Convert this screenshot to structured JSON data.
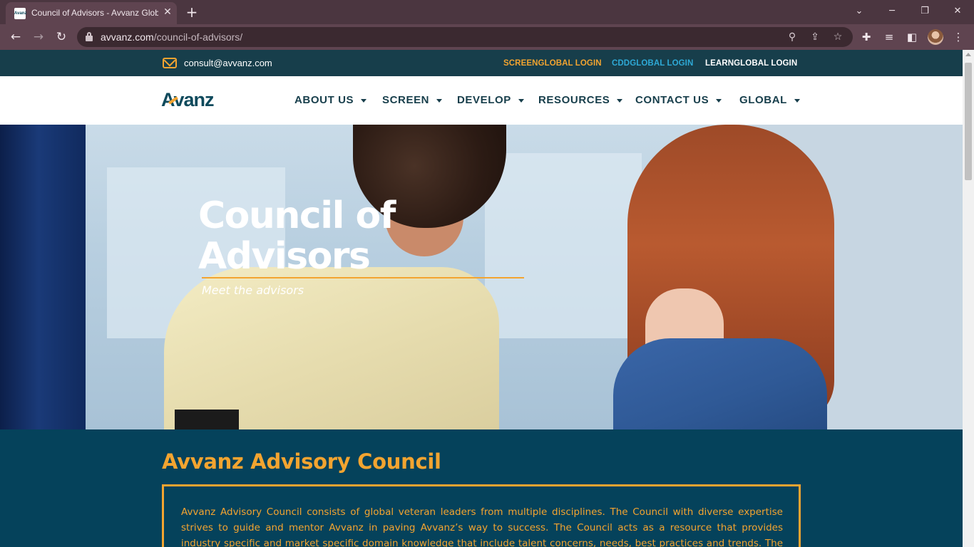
{
  "browser": {
    "tab_title": "Council of Advisors - Avvanz Global",
    "favicon_text": "Avanz",
    "url_host": "avvanz.com",
    "url_path": "/council-of-advisors/"
  },
  "topbar": {
    "email": "consult@avvanz.com",
    "logins": [
      {
        "label": "SCREENGLOBAL LOGIN",
        "color": "#f3a430"
      },
      {
        "label": "CDDGLOBAL LOGIN",
        "color": "#2ea9d6"
      },
      {
        "label": "LEARNGLOBAL LOGIN",
        "color": "#ffffff"
      }
    ]
  },
  "header": {
    "logo": "Avanz",
    "nav": [
      "ABOUT US",
      "SCREEN",
      "DEVELOP",
      "RESOURCES",
      "CONTACT US",
      "GLOBAL"
    ]
  },
  "hero": {
    "title_line1": "Council of",
    "title_line2": "Advisors",
    "subtitle": "Meet the advisors"
  },
  "council": {
    "title": "Avvanz Advisory Council",
    "body": "Avvanz Advisory Council consists of global veteran leaders from multiple disciplines. The Council with diverse expertise strives to guide and mentor Avvanz in paving Avvanz’s way to success. The Council acts as a resource that provides industry specific and market specific domain knowledge that include talent concerns, needs, best practices and trends. The Council also offers"
  },
  "colors": {
    "accent": "#f3a430",
    "brand_dark": "#173e4b",
    "section_bg": "#05425b",
    "browser_frame": "#4b3640"
  }
}
